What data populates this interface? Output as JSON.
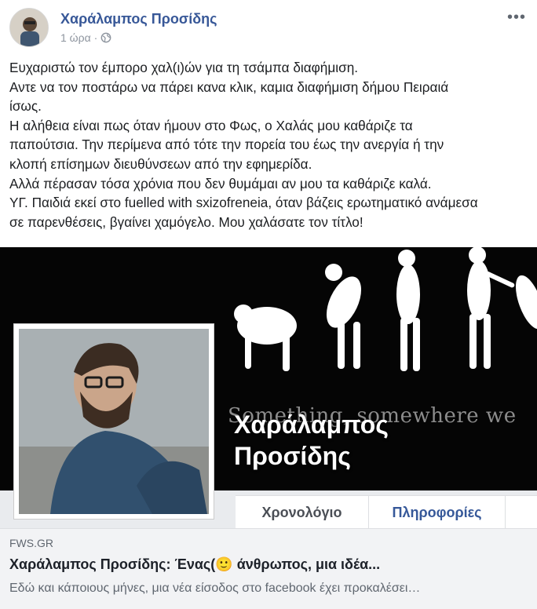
{
  "post": {
    "author": "Χαράλαμπος Προσίδης",
    "time": "1 ώρα",
    "separator": "·",
    "privacy_icon": "globe-icon",
    "more_icon": "more-options-icon",
    "more_glyph": "•••",
    "lines": [
      "Ευχαριστώ τον έμπορο χαλ(ι)ών για τη τσάμπα διαφήμιση.",
      "Αντε να τον ποστάρω να πάρει κανα κλικ, καμια διαφήμιση δήμου Πειραιά",
      "ίσως.",
      "Η αλήθεια είναι πως όταν ήμουν στο Φως, ο Χαλάς μου καθάριζε τα",
      "παπούτσια. Την περίμενα από τότε την πορεία του έως την ανεργία ή την",
      "κλοπή επίσημων διευθύνσεων από την εφημερίδα.",
      "Αλλά πέρασαν τόσα χρόνια που δεν θυμάμαι αν μου τα καθάριζε καλά.",
      "ΥΓ. Παιδιά εκεί στο fuelled with sxizofreneia, όταν βάζεις ερωτηματικό ανάμεσα",
      "σε παρενθέσεις, βγαίνει χαμόγελο. Μου χαλάσατε τον τίτλο!"
    ]
  },
  "preview": {
    "cover_tagline": "Something, somewhere we",
    "cover_name_line1": "Χαράλαμπος",
    "cover_name_line2": "Προσίδης",
    "tab_timeline": "Χρονολόγιο",
    "tab_about": "Πληροφορίες"
  },
  "link": {
    "domain": "FWS.GR",
    "title": "Χαράλαμπος Προσίδης: Ένας(🙂 άνθρωπος, μια ιδέα...",
    "description": "Εδώ και κάποιους μήνες, μια νέα είσοδος στο facebook έχει προκαλέσει…"
  },
  "colors": {
    "author_link": "#385898",
    "meta": "#8d949e",
    "link_bg": "#f2f3f5",
    "tab_active": "#365899"
  }
}
